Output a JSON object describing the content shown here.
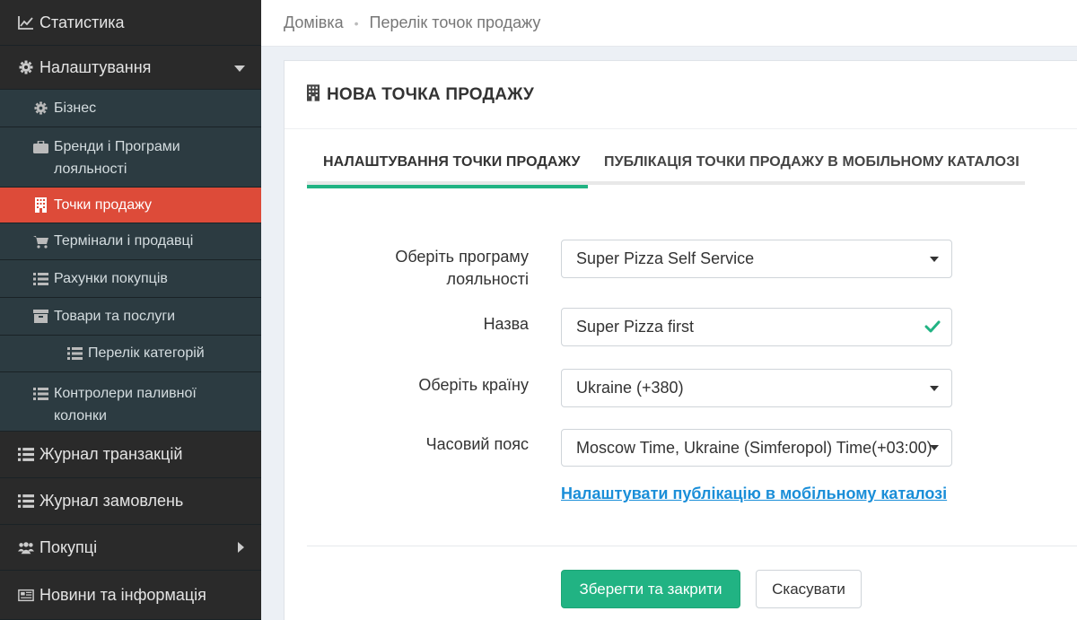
{
  "sidebar": {
    "items": [
      {
        "label": "Статистика",
        "icon": "line-chart-icon"
      },
      {
        "label": "Налаштування",
        "icon": "gear-icon"
      },
      {
        "label": "Бізнес",
        "icon": "gear-icon"
      },
      {
        "label": "Бренди і Програми лояльності",
        "icon": "briefcase-icon"
      },
      {
        "label": "Точки продажу",
        "icon": "building-icon"
      },
      {
        "label": "Термінали і продавці",
        "icon": "cart-icon"
      },
      {
        "label": "Рахунки покупців",
        "icon": "list-icon"
      },
      {
        "label": "Товари та послуги",
        "icon": "archive-icon"
      },
      {
        "label": "Перелік категорій",
        "icon": "list-icon"
      },
      {
        "label": "Контролери паливної колонки",
        "icon": "list-icon"
      },
      {
        "label": "Журнал транзакцій",
        "icon": "list-icon"
      },
      {
        "label": "Журнал замовлень",
        "icon": "list-icon"
      },
      {
        "label": "Покупці",
        "icon": "users-icon"
      },
      {
        "label": "Новини та інформація",
        "icon": "newspaper-icon"
      }
    ],
    "active_color": "#dd4b39"
  },
  "breadcrumb": {
    "home": "Домівка",
    "current": "Перелік точок продажу"
  },
  "panel": {
    "title": "НОВА ТОЧКА ПРОДАЖУ",
    "icon": "building-icon"
  },
  "tabs": [
    {
      "label": "НАЛАШТУВАННЯ ТОЧКИ ПРОДАЖУ",
      "active": true
    },
    {
      "label": "ПУБЛІКАЦІЯ ТОЧКИ ПРОДАЖУ В МОБІЛЬНОМУ КАТАЛОЗІ",
      "active": false
    }
  ],
  "form": {
    "loyalty_label": "Оберіть програму лояльності",
    "loyalty_value": "Super Pizza Self Service",
    "name_label": "Назва",
    "name_value": "Super Pizza first",
    "country_label": "Оберіть країну",
    "country_value": "Ukraine (+380)",
    "timezone_label": "Часовий пояс",
    "timezone_value": "Moscow Time, Ukraine (Simferopol) Time(+03:00)",
    "publish_link": "Налаштувати публікацію в мобільному каталозі"
  },
  "buttons": {
    "save": "Зберегти та закрити",
    "cancel": "Скасувати"
  },
  "colors": {
    "accent": "#21b383",
    "link": "#1a8ed8",
    "sidebar_bg": "#2a2a2a"
  }
}
